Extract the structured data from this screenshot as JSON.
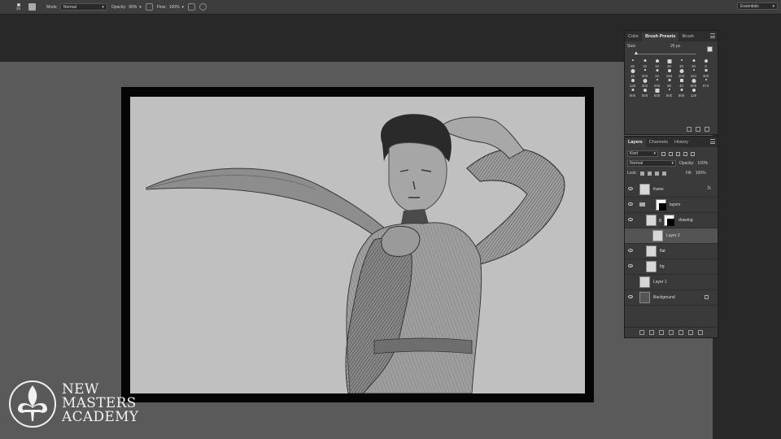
{
  "options_bar": {
    "brush_size": "25",
    "mode_label": "Mode:",
    "mode_value": "Normal",
    "opacity_label": "Opacity:",
    "opacity_value": "90%",
    "flow_label": "Flow:",
    "flow_value": "100%",
    "workspace": "Essentials"
  },
  "watermark": {
    "line1": "NEW",
    "line2": "MASTERS",
    "line3": "ACADEMY"
  },
  "brush_panel": {
    "tabs": [
      "Color",
      "Brush Presets",
      "Brush"
    ],
    "active_tab": "Brush Presets",
    "size_label": "Size:",
    "size_value": "25 px",
    "size_fraction": 0.05,
    "presets": [
      "35",
      "15",
      "10",
      "30",
      "30",
      "30",
      "9",
      "15",
      "200",
      "10",
      "150",
      "100",
      "151",
      "300",
      "126",
      "302",
      "200",
      "90",
      "40",
      "600",
      "674",
      "600",
      "500",
      "500",
      "500",
      "500",
      "126"
    ]
  },
  "layers_panel": {
    "tabs": [
      "Layers",
      "Channels",
      "History"
    ],
    "active_tab": "Layers",
    "filter_kind": "Kind",
    "blend_mode": "Normal",
    "opacity_label": "Opacity:",
    "opacity_value": "100%",
    "lock_label": "Lock:",
    "fill_label": "Fill:",
    "fill_value": "100%",
    "layers": [
      {
        "name": "frame",
        "visible": true,
        "fx": "fx"
      },
      {
        "name": "layers",
        "visible": true,
        "group": true
      },
      {
        "name": "drawing",
        "visible": true
      },
      {
        "name": "Layer 2",
        "visible": false,
        "selected": true
      },
      {
        "name": "flat",
        "visible": true
      },
      {
        "name": "bg",
        "visible": true
      },
      {
        "name": "Layer 1",
        "visible": false
      },
      {
        "name": "Background",
        "visible": true,
        "locked": true
      }
    ]
  },
  "colors": {
    "ui_bg": "#282828",
    "canvas_bg": "#5a5a5a",
    "panel_bg": "#3a3a3a",
    "paper": "#c0c0c0"
  }
}
